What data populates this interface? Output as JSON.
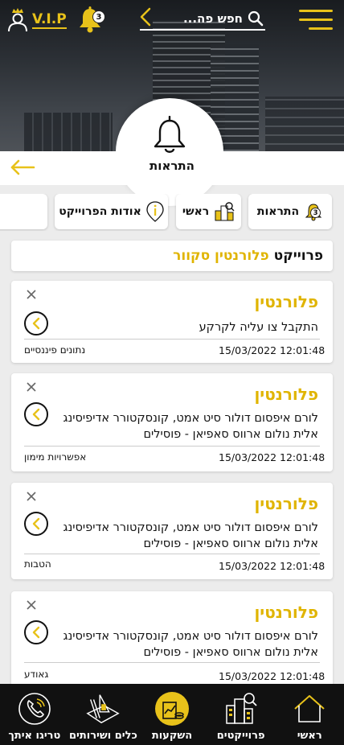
{
  "header": {
    "vip_label": "V.I.P",
    "notifications_count": "3",
    "search_placeholder": "חפש פה..."
  },
  "page": {
    "title": "התראות"
  },
  "chips": [
    {
      "label": "התראות",
      "badge": "3",
      "icon": "bell-icon"
    },
    {
      "label": "ראשי",
      "icon": "buildings-icon"
    },
    {
      "label": "אודות הפרוייקט",
      "icon": "info-icon"
    },
    {
      "label": "",
      "icon": "monitor-icon"
    }
  ],
  "project": {
    "prefix": "פרוייקט",
    "name": "פלורנטין סקוור"
  },
  "notifications": [
    {
      "title": "פלורנטין",
      "body": "התקבל צו עליה לקרקע",
      "datetime": "15/03/2022 12:01:48",
      "category": "נתונים פיננסיים"
    },
    {
      "title": "פלורנטין",
      "body": "לורם איפסום דולור סיט אמט, קונסקטורר אדיפיסינג אלית נולום ארווס סאפיאן - פוסילים",
      "datetime": "15/03/2022 12:01:48",
      "category": "אפשרויות מימון"
    },
    {
      "title": "פלורנטין",
      "body": "לורם איפסום דולור סיט אמט, קונסקטורר אדיפיסינג אלית נולום ארווס סאפיאן - פוסילים",
      "datetime": "15/03/2022 12:01:48",
      "category": "הטבות"
    },
    {
      "title": "פלורנטין",
      "body": "לורם איפסום דולור סיט אמט, קונסקטורר אדיפיסינג אלית נולום ארווס סאפיאן - פוסילים",
      "datetime": "15/03/2022 12:01:48",
      "category": "גאודע"
    }
  ],
  "bottom_nav": [
    {
      "label": "ראשי",
      "icon": "home-icon"
    },
    {
      "label": "פרוייקטים",
      "icon": "projects-icon"
    },
    {
      "label": "השקעות",
      "icon": "investments-icon"
    },
    {
      "label": "כלים ושירותים",
      "icon": "tools-icon"
    },
    {
      "label": "טריגו איתך",
      "icon": "phone-icon"
    }
  ],
  "colors": {
    "accent": "#e8c21a",
    "dark": "#111111",
    "background": "#ececec"
  }
}
